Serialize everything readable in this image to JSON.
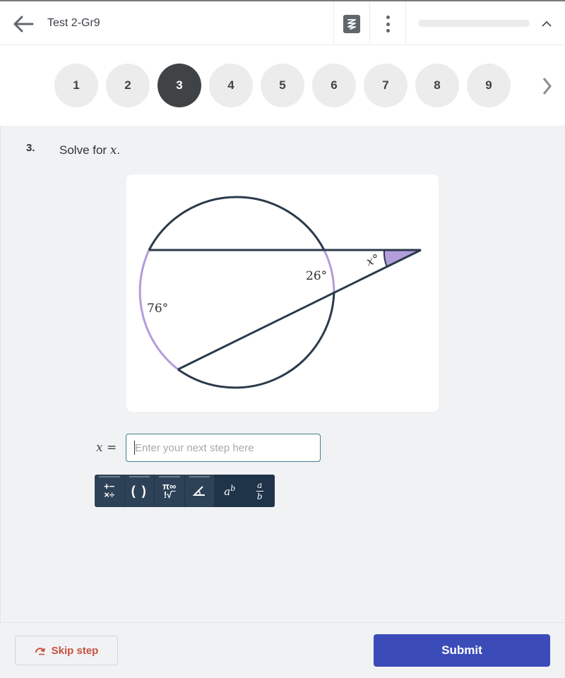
{
  "header": {
    "title": "Test 2-Gr9",
    "back_icon": "arrow-left-icon",
    "app_icon": "zigzag-logo-icon",
    "menu_icon": "kebab-menu-icon",
    "collapse_icon": "chevron-up-icon",
    "progress_fraction": 0
  },
  "question_nav": {
    "items": [
      "1",
      "2",
      "3",
      "4",
      "5",
      "6",
      "7",
      "8",
      "9"
    ],
    "active": "3",
    "next_icon": "chevron-right-icon"
  },
  "question": {
    "number": "3.",
    "prompt": "Solve for ",
    "variable": "x",
    "prompt_end": ".",
    "figure": {
      "arc_far_label": "76°",
      "arc_near_label": "26°",
      "angle_label": "x°",
      "colors": {
        "line": "#2b3a4a",
        "arc_highlight": "#b39ddb",
        "angle_fill": "#b39ddb"
      }
    }
  },
  "answer": {
    "label_var": "x",
    "label_eq": " =",
    "placeholder": "Enter your next step here",
    "value": ""
  },
  "math_toolbar": {
    "buttons": [
      {
        "name": "operators",
        "icon": "operators-icon",
        "line1": "+−",
        "line2": "×÷"
      },
      {
        "name": "parentheses",
        "icon": "parentheses-icon",
        "text": "( )"
      },
      {
        "name": "symbols",
        "icon": "symbols-icon",
        "line1": "π∞",
        "line2": "!√‾"
      },
      {
        "name": "angle",
        "icon": "angle-icon",
        "text": "∠"
      },
      {
        "name": "exponent",
        "icon": "exponent-icon",
        "base": "a",
        "exp": "b"
      },
      {
        "name": "fraction",
        "icon": "fraction-icon",
        "num": "a",
        "den": "b"
      }
    ]
  },
  "footer": {
    "skip_label": "Skip step",
    "skip_icon": "skip-arrow-icon",
    "submit_label": "Submit",
    "submit_color": "#3b4cb9",
    "skip_color": "#c8503f"
  }
}
